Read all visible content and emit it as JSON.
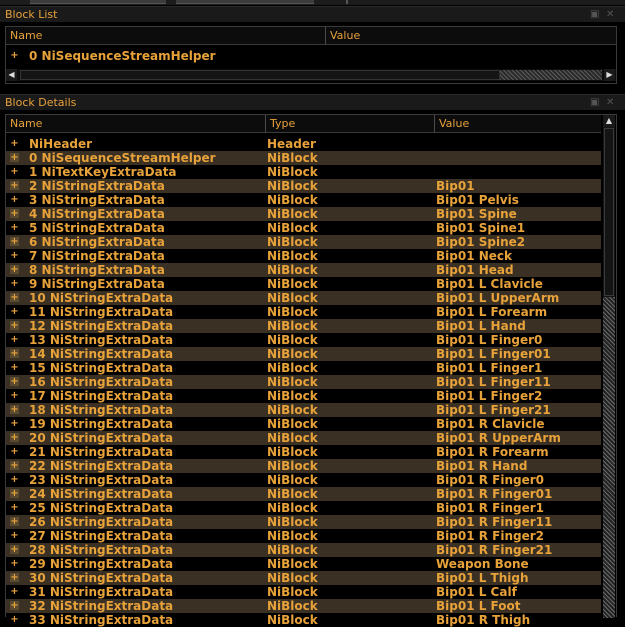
{
  "block_list": {
    "title": "Block List",
    "columns": {
      "name": "Name",
      "value": "Value"
    },
    "items": [
      {
        "expander": "+",
        "name": "0 NiSequenceStreamHelper"
      }
    ]
  },
  "block_details": {
    "title": "Block Details",
    "columns": {
      "name": "Name",
      "type": "Type",
      "value": "Value"
    },
    "rows": [
      {
        "name": "NiHeader",
        "type": "Header",
        "value": ""
      },
      {
        "name": "0 NiSequenceStreamHelper",
        "type": "NiBlock",
        "value": ""
      },
      {
        "name": "1 NiTextKeyExtraData",
        "type": "NiBlock",
        "value": ""
      },
      {
        "name": "2 NiStringExtraData",
        "type": "NiBlock",
        "value": "Bip01"
      },
      {
        "name": "3 NiStringExtraData",
        "type": "NiBlock",
        "value": "Bip01 Pelvis"
      },
      {
        "name": "4 NiStringExtraData",
        "type": "NiBlock",
        "value": "Bip01 Spine"
      },
      {
        "name": "5 NiStringExtraData",
        "type": "NiBlock",
        "value": "Bip01 Spine1"
      },
      {
        "name": "6 NiStringExtraData",
        "type": "NiBlock",
        "value": "Bip01 Spine2"
      },
      {
        "name": "7 NiStringExtraData",
        "type": "NiBlock",
        "value": "Bip01 Neck"
      },
      {
        "name": "8 NiStringExtraData",
        "type": "NiBlock",
        "value": "Bip01 Head"
      },
      {
        "name": "9 NiStringExtraData",
        "type": "NiBlock",
        "value": "Bip01 L Clavicle"
      },
      {
        "name": "10 NiStringExtraData",
        "type": "NiBlock",
        "value": "Bip01 L UpperArm"
      },
      {
        "name": "11 NiStringExtraData",
        "type": "NiBlock",
        "value": "Bip01 L Forearm"
      },
      {
        "name": "12 NiStringExtraData",
        "type": "NiBlock",
        "value": "Bip01 L Hand"
      },
      {
        "name": "13 NiStringExtraData",
        "type": "NiBlock",
        "value": "Bip01 L Finger0"
      },
      {
        "name": "14 NiStringExtraData",
        "type": "NiBlock",
        "value": "Bip01 L Finger01"
      },
      {
        "name": "15 NiStringExtraData",
        "type": "NiBlock",
        "value": "Bip01 L Finger1"
      },
      {
        "name": "16 NiStringExtraData",
        "type": "NiBlock",
        "value": "Bip01 L Finger11"
      },
      {
        "name": "17 NiStringExtraData",
        "type": "NiBlock",
        "value": "Bip01 L Finger2"
      },
      {
        "name": "18 NiStringExtraData",
        "type": "NiBlock",
        "value": "Bip01 L Finger21"
      },
      {
        "name": "19 NiStringExtraData",
        "type": "NiBlock",
        "value": "Bip01 R Clavicle"
      },
      {
        "name": "20 NiStringExtraData",
        "type": "NiBlock",
        "value": "Bip01 R UpperArm"
      },
      {
        "name": "21 NiStringExtraData",
        "type": "NiBlock",
        "value": "Bip01 R Forearm"
      },
      {
        "name": "22 NiStringExtraData",
        "type": "NiBlock",
        "value": "Bip01 R Hand"
      },
      {
        "name": "23 NiStringExtraData",
        "type": "NiBlock",
        "value": "Bip01 R Finger0"
      },
      {
        "name": "24 NiStringExtraData",
        "type": "NiBlock",
        "value": "Bip01 R Finger01"
      },
      {
        "name": "25 NiStringExtraData",
        "type": "NiBlock",
        "value": "Bip01 R Finger1"
      },
      {
        "name": "26 NiStringExtraData",
        "type": "NiBlock",
        "value": "Bip01 R Finger11"
      },
      {
        "name": "27 NiStringExtraData",
        "type": "NiBlock",
        "value": "Bip01 R Finger2"
      },
      {
        "name": "28 NiStringExtraData",
        "type": "NiBlock",
        "value": "Bip01 R Finger21"
      },
      {
        "name": "29 NiStringExtraData",
        "type": "NiBlock",
        "value": "Weapon Bone"
      },
      {
        "name": "30 NiStringExtraData",
        "type": "NiBlock",
        "value": "Bip01 L Thigh"
      },
      {
        "name": "31 NiStringExtraData",
        "type": "NiBlock",
        "value": "Bip01 L Calf"
      },
      {
        "name": "32 NiStringExtraData",
        "type": "NiBlock",
        "value": "Bip01 L Foot"
      },
      {
        "name": "33 NiStringExtraData",
        "type": "NiBlock",
        "value": "Bip01 R Thigh"
      }
    ]
  },
  "icons": {
    "expander": "plus-expander-icon",
    "scroll_left": "arrow-left-icon",
    "scroll_right": "arrow-right-icon",
    "scroll_up": "arrow-up-icon"
  },
  "colors": {
    "text": "#e8a23a",
    "row_alt": "#3a3024",
    "background": "#000000"
  }
}
